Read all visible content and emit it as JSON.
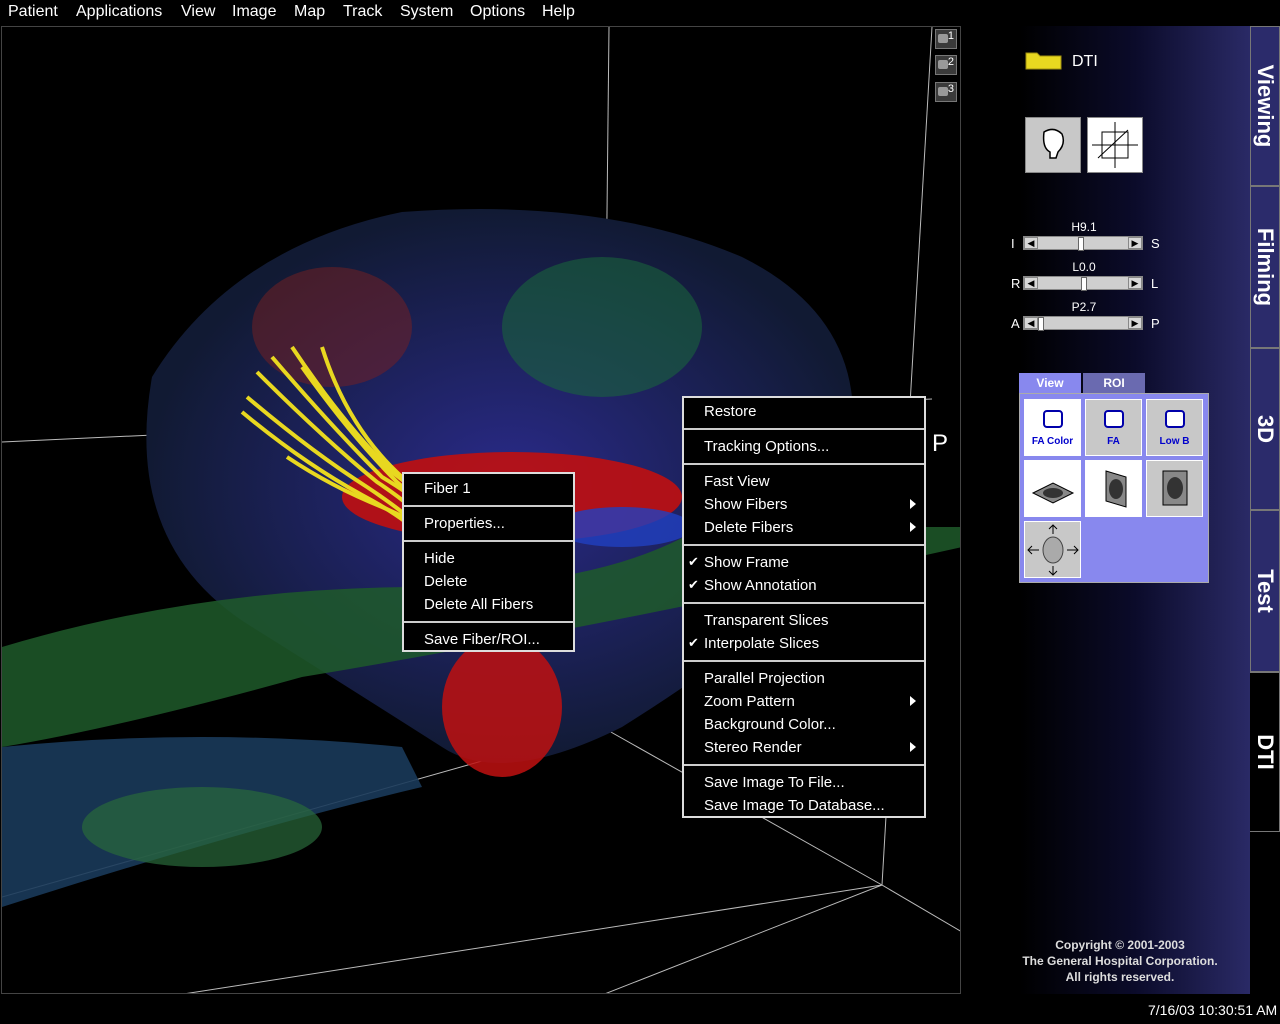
{
  "menubar": {
    "items": [
      {
        "label": "Patient",
        "mnemonic": "P"
      },
      {
        "label": "Applications",
        "mnemonic": "A"
      },
      {
        "label": "View",
        "mnemonic": "V"
      },
      {
        "label": "Image",
        "mnemonic": "I"
      },
      {
        "label": "Map",
        "mnemonic": "M"
      },
      {
        "label": "Track",
        "mnemonic": "T"
      },
      {
        "label": "System",
        "mnemonic": "S"
      },
      {
        "label": "Options",
        "mnemonic": "O"
      },
      {
        "label": "Help",
        "mnemonic": "H"
      }
    ]
  },
  "viewport": {
    "orientation_label": "P",
    "snapshot_buttons": [
      "1",
      "2",
      "3"
    ],
    "fiber_color": "#e8d820"
  },
  "fiber_menu": {
    "items": [
      {
        "label": "Fiber 1"
      },
      {
        "label": "Properties..."
      },
      {
        "label": "Hide"
      },
      {
        "label": "Delete"
      },
      {
        "label": "Delete All Fibers"
      },
      {
        "label": "Save Fiber/ROI..."
      }
    ]
  },
  "context_menu": {
    "items": [
      {
        "label": "Restore"
      },
      {
        "label": "Tracking Options..."
      },
      {
        "label": "Fast View"
      },
      {
        "label": "Show Fibers",
        "submenu": true
      },
      {
        "label": "Delete Fibers",
        "submenu": true
      },
      {
        "label": "Show Frame",
        "checked": true
      },
      {
        "label": "Show Annotation",
        "checked": true
      },
      {
        "label": "Transparent Slices"
      },
      {
        "label": "Interpolate Slices",
        "checked": true
      },
      {
        "label": "Parallel Projection"
      },
      {
        "label": "Zoom Pattern",
        "submenu": true
      },
      {
        "label": "Background Color..."
      },
      {
        "label": "Stereo Render",
        "submenu": true
      },
      {
        "label": "Save Image To File..."
      },
      {
        "label": "Save Image To Database..."
      }
    ]
  },
  "panel": {
    "folder_label": "DTI",
    "folder_icon": "folder-icon",
    "sliders": [
      {
        "title": "H9.1",
        "left": "I",
        "right": "S",
        "position": 0.47
      },
      {
        "title": "L0.0",
        "left": "R",
        "right": "L",
        "position": 0.5
      },
      {
        "title": "P2.7",
        "left": "A",
        "right": "P",
        "position": 0.0
      }
    ],
    "view_tabs": [
      "View",
      "ROI"
    ],
    "tiles": [
      "FA Color",
      "FA",
      "Low B"
    ],
    "copyright": [
      "Copyright © 2001-2003",
      "The General Hospital Corporation.",
      "All rights reserved."
    ]
  },
  "side_tabs": [
    "Viewing",
    "Filming",
    "3D",
    "Test",
    "DTI"
  ],
  "status": {
    "datetime": "7/16/03 10:30:51 AM"
  },
  "colors": {
    "panel_blue": "#2b2b6b",
    "tile_panel": "#8888ee",
    "menu_bg": "#000000"
  }
}
